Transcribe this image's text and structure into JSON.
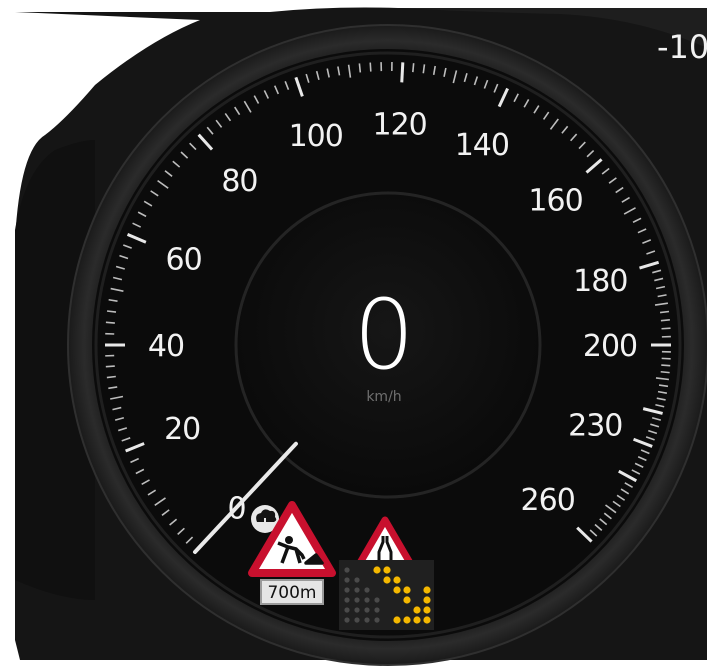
{
  "speedometer": {
    "current_speed": "0",
    "unit": "km/h",
    "needle_value": 0,
    "dial_labels": [
      {
        "text": "0",
        "value": 0
      },
      {
        "text": "20",
        "value": 20
      },
      {
        "text": "40",
        "value": 40
      },
      {
        "text": "60",
        "value": 60
      },
      {
        "text": "80",
        "value": 80
      },
      {
        "text": "100",
        "value": 100
      },
      {
        "text": "120",
        "value": 120
      },
      {
        "text": "140",
        "value": 140
      },
      {
        "text": "160",
        "value": 160
      },
      {
        "text": "180",
        "value": 180
      },
      {
        "text": "200",
        "value": 200
      },
      {
        "text": "230",
        "value": 230
      },
      {
        "text": "260",
        "value": 260
      }
    ]
  },
  "adjacent_gauge": {
    "partial_label": "-10"
  },
  "road_signs": {
    "roadworks": {
      "icon": "roadworks-sign-icon",
      "distance": "700m",
      "source_icon": "cloud-download-icon"
    },
    "narrowing": {
      "icon": "road-narrows-sign-icon",
      "arrow_board": "flashing-arrow-board-icon"
    }
  },
  "colors": {
    "background": "#151515",
    "sign_red": "#c8102e",
    "arrow_amber": "#f5b800",
    "text": "#f2f2f2"
  }
}
